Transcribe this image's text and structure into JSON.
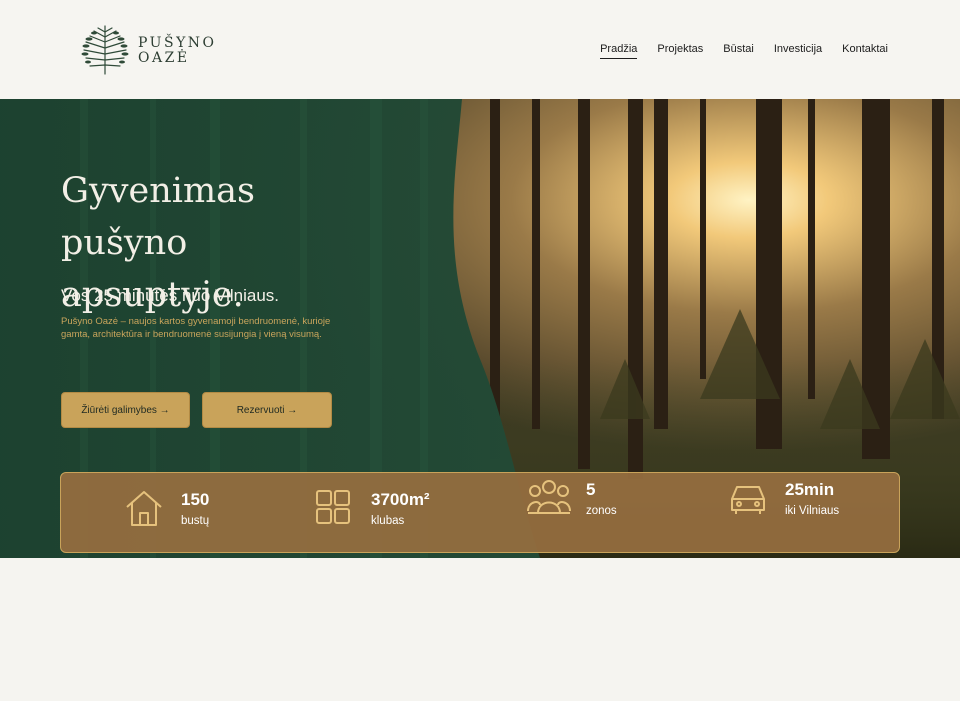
{
  "header": {
    "logo": {
      "line1": "PUŠYNO",
      "line2": "OAZĖ",
      "icon": "pine-tree-icon"
    },
    "nav": [
      {
        "label": "Pradžia",
        "active": true
      },
      {
        "label": "Projektas",
        "active": false
      },
      {
        "label": "Būstai",
        "active": false
      },
      {
        "label": "Investicija",
        "active": false
      },
      {
        "label": "Kontaktai",
        "active": false
      }
    ]
  },
  "hero": {
    "title_line1": "Gyvenimas pušyno",
    "title_line2": "apsuptyje.",
    "subtitle": "Vos 25 minutės nuo Vilniaus.",
    "description": "Pušyno Oazė – naujos kartos gyvenamoji bendruomenė, kurioje gamta, architektūra ir bendruomenė susijungia į vieną visumą.",
    "buttons": {
      "primary": "Žiūrėti galimybes →",
      "secondary": "Rezervuoti →"
    }
  },
  "stats": [
    {
      "value": "150",
      "label": "bustų",
      "icon": "house-icon"
    },
    {
      "value": "3700m²",
      "label": "klubas",
      "icon": "grid-icon"
    },
    {
      "value": "5",
      "label": "zonos",
      "icon": "people-icon"
    },
    {
      "value": "25min",
      "label": "iki Vilniaus",
      "icon": "car-icon"
    }
  ],
  "colors": {
    "green": "#1f4533",
    "gold": "#c9a35a",
    "stats_bg": "#966e40",
    "cream": "#f5f4f0"
  }
}
